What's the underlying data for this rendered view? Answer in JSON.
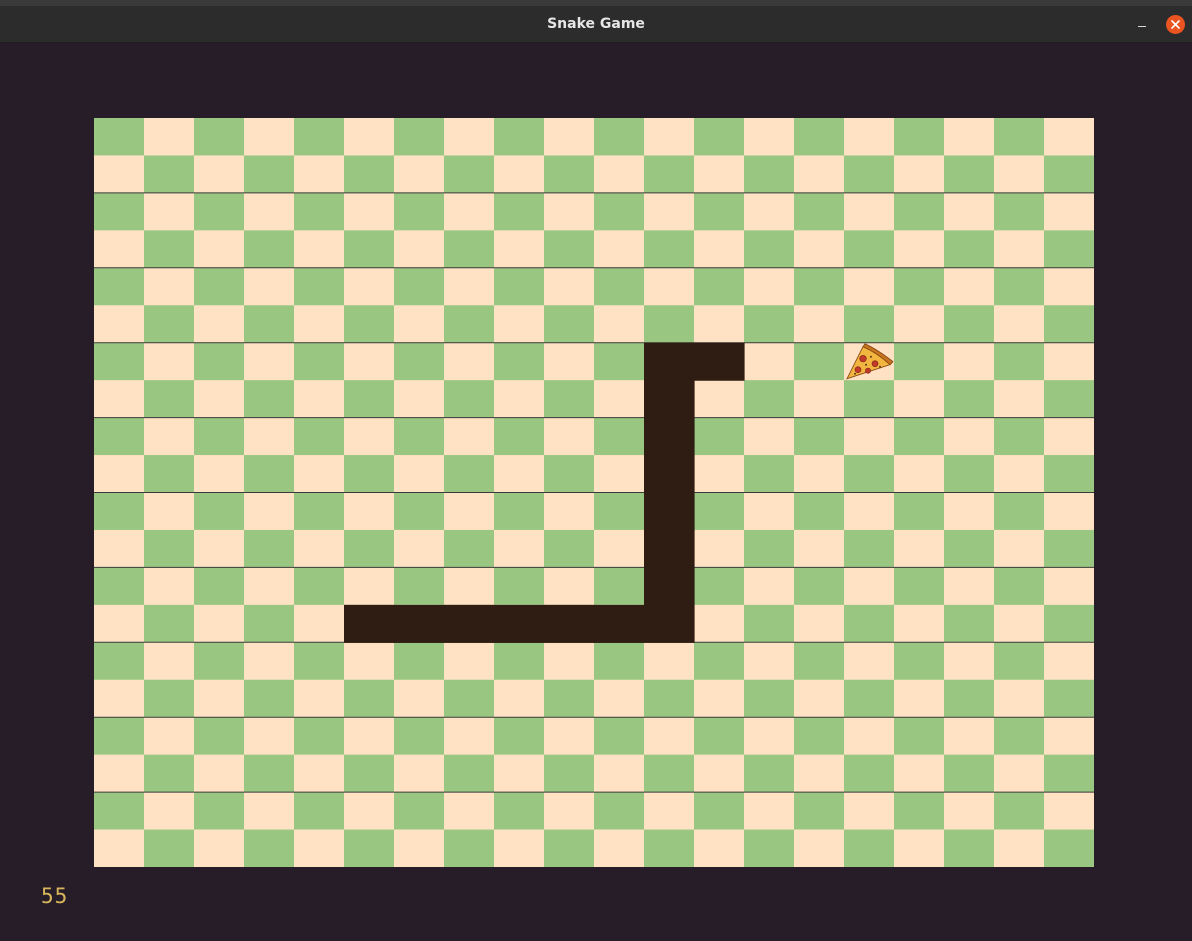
{
  "window": {
    "title": "Snake Game",
    "controls": [
      "minimize",
      "close"
    ]
  },
  "game": {
    "grid": {
      "columns": 20,
      "rows": 20
    },
    "colors": {
      "background": "#261d29",
      "cell_light": "#ffe2c4",
      "cell_dark": "#99c782",
      "band_line": "#3a3a3a",
      "snake": "#2f1d13",
      "score_text": "#d8b75c",
      "close_button": "#e95420"
    },
    "snake": {
      "segments": [
        [
          12,
          6
        ],
        [
          11,
          6
        ],
        [
          11,
          7
        ],
        [
          11,
          8
        ],
        [
          11,
          9
        ],
        [
          11,
          10
        ],
        [
          11,
          11
        ],
        [
          11,
          12
        ],
        [
          11,
          13
        ],
        [
          10,
          13
        ],
        [
          9,
          13
        ],
        [
          8,
          13
        ],
        [
          7,
          13
        ],
        [
          6,
          13
        ],
        [
          5,
          13
        ]
      ]
    },
    "food": {
      "type": "pizza-slice",
      "cell": [
        15,
        6
      ]
    },
    "score": "55"
  }
}
